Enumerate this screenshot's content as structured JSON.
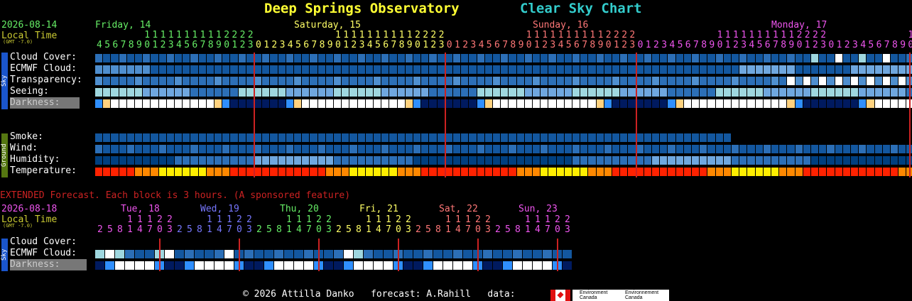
{
  "title": {
    "observatory": "Deep Springs Observatory",
    "chart": "Clear Sky Chart"
  },
  "header": {
    "date": "2026-08-14",
    "local_time": "Local Time",
    "gmt": "(GMT -7.0)",
    "days": [
      {
        "label": "Friday, 14",
        "color": "#66ee66"
      },
      {
        "label": "Saturday, 15",
        "color": "#ffff66"
      },
      {
        "label": "Sunday, 16",
        "color": "#ff7777"
      },
      {
        "label": "Monday, 17",
        "color": "#ee55ee"
      }
    ],
    "hour_tens": "1111111222",
    "hours_start": 4
  },
  "rows": {
    "cloud_cover": "Cloud Cover:",
    "ecmwf_cloud": "ECMWF Cloud:",
    "transparency": "Transparency:",
    "seeing": "Seeing:",
    "darkness": "Darkness:",
    "smoke": "Smoke:",
    "wind": "Wind:",
    "humidity": "Humidity:",
    "temperature": "Temperature:"
  },
  "side_labels": {
    "sky": "Sky",
    "ground": "Ground"
  },
  "extended": {
    "notice": "EXTENDED Forecast. Each block is 3 hours. (A sponsored feature)",
    "date": "2026-08-18",
    "local_time": "Local Time",
    "gmt": "(GMT -7.0)",
    "days": [
      {
        "label": "Tue, 18",
        "color": "#ee55ee"
      },
      {
        "label": "Wed, 19",
        "color": "#7777ff"
      },
      {
        "label": "Thu, 20",
        "color": "#66ee66"
      },
      {
        "label": "Fri, 21",
        "color": "#ffff66"
      },
      {
        "label": "Sat, 22",
        "color": "#ff7777"
      },
      {
        "label": "Sun, 23",
        "color": "#ee55ee"
      }
    ],
    "tens": "11122",
    "hours": "25814703",
    "rows": {
      "cloud_cover": "Cloud Cover:",
      "ecmwf_cloud": "ECMWF Cloud:",
      "darkness": "Darkness:"
    }
  },
  "footer": {
    "copyright": "© 2026 Attilla Danko",
    "forecast": "forecast: A.Rahill",
    "data": "data:",
    "logo_text_1": "Environment Canada",
    "logo_text_2": "Environnement Canada"
  },
  "colors": {
    "deep_blue": "#003f7f",
    "mid_blue": "#13579f",
    "blue": "#2c6fb7",
    "light_blue": "#4f8fcf",
    "sky_blue": "#6fa7df",
    "pale_cyan": "#9fd7df",
    "white": "#ffffff",
    "grey": "#c0c0c0",
    "red_line": "#cc2222",
    "temp_red": "#ff2200",
    "temp_orange": "#ff8800",
    "temp_yellow": "#ffee00"
  }
}
